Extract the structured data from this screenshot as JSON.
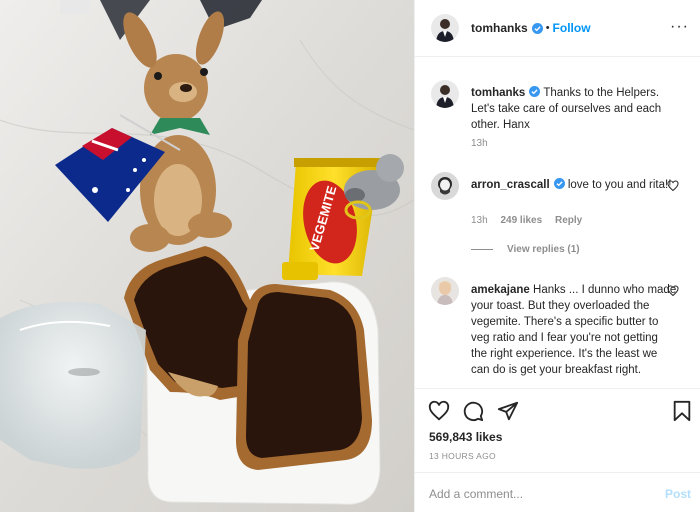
{
  "photo": {
    "jar_text": "VEGEMITE"
  },
  "header": {
    "username": "tomhanks",
    "separator": "•",
    "follow_label": "Follow",
    "more_label": "···",
    "verified_icon": "verified-badge-icon"
  },
  "comments": [
    {
      "username": "tomhanks",
      "verified": true,
      "text": "Thanks to the Helpers. Let's take care of ourselves and each other. Hanx",
      "time": "13h"
    },
    {
      "username": "arron_crascall",
      "verified": true,
      "text": "love to you and rita!!",
      "time": "13h",
      "likes": "249 likes",
      "reply_label": "Reply",
      "view_replies": "View replies (1)"
    },
    {
      "username": "amekajane",
      "verified": false,
      "text": "Hanks ... I dunno who made your toast. But they overloaded the vegemite. There's a specific butter to veg ratio and I fear you're not getting the right experience. It's the least we can do is get your breakfast right."
    }
  ],
  "actions": {
    "icons": [
      "heart-icon",
      "comment-icon",
      "share-icon",
      "bookmark-icon"
    ],
    "likes": "569,843 likes",
    "date": "13 HOURS AGO"
  },
  "add_comment": {
    "placeholder": "Add a comment...",
    "post_label": "Post"
  },
  "colors": {
    "accent": "#0095f6",
    "text": "#262626",
    "muted": "#8e8e8e",
    "border": "#efefef",
    "post_disabled": "#b2dffc"
  }
}
